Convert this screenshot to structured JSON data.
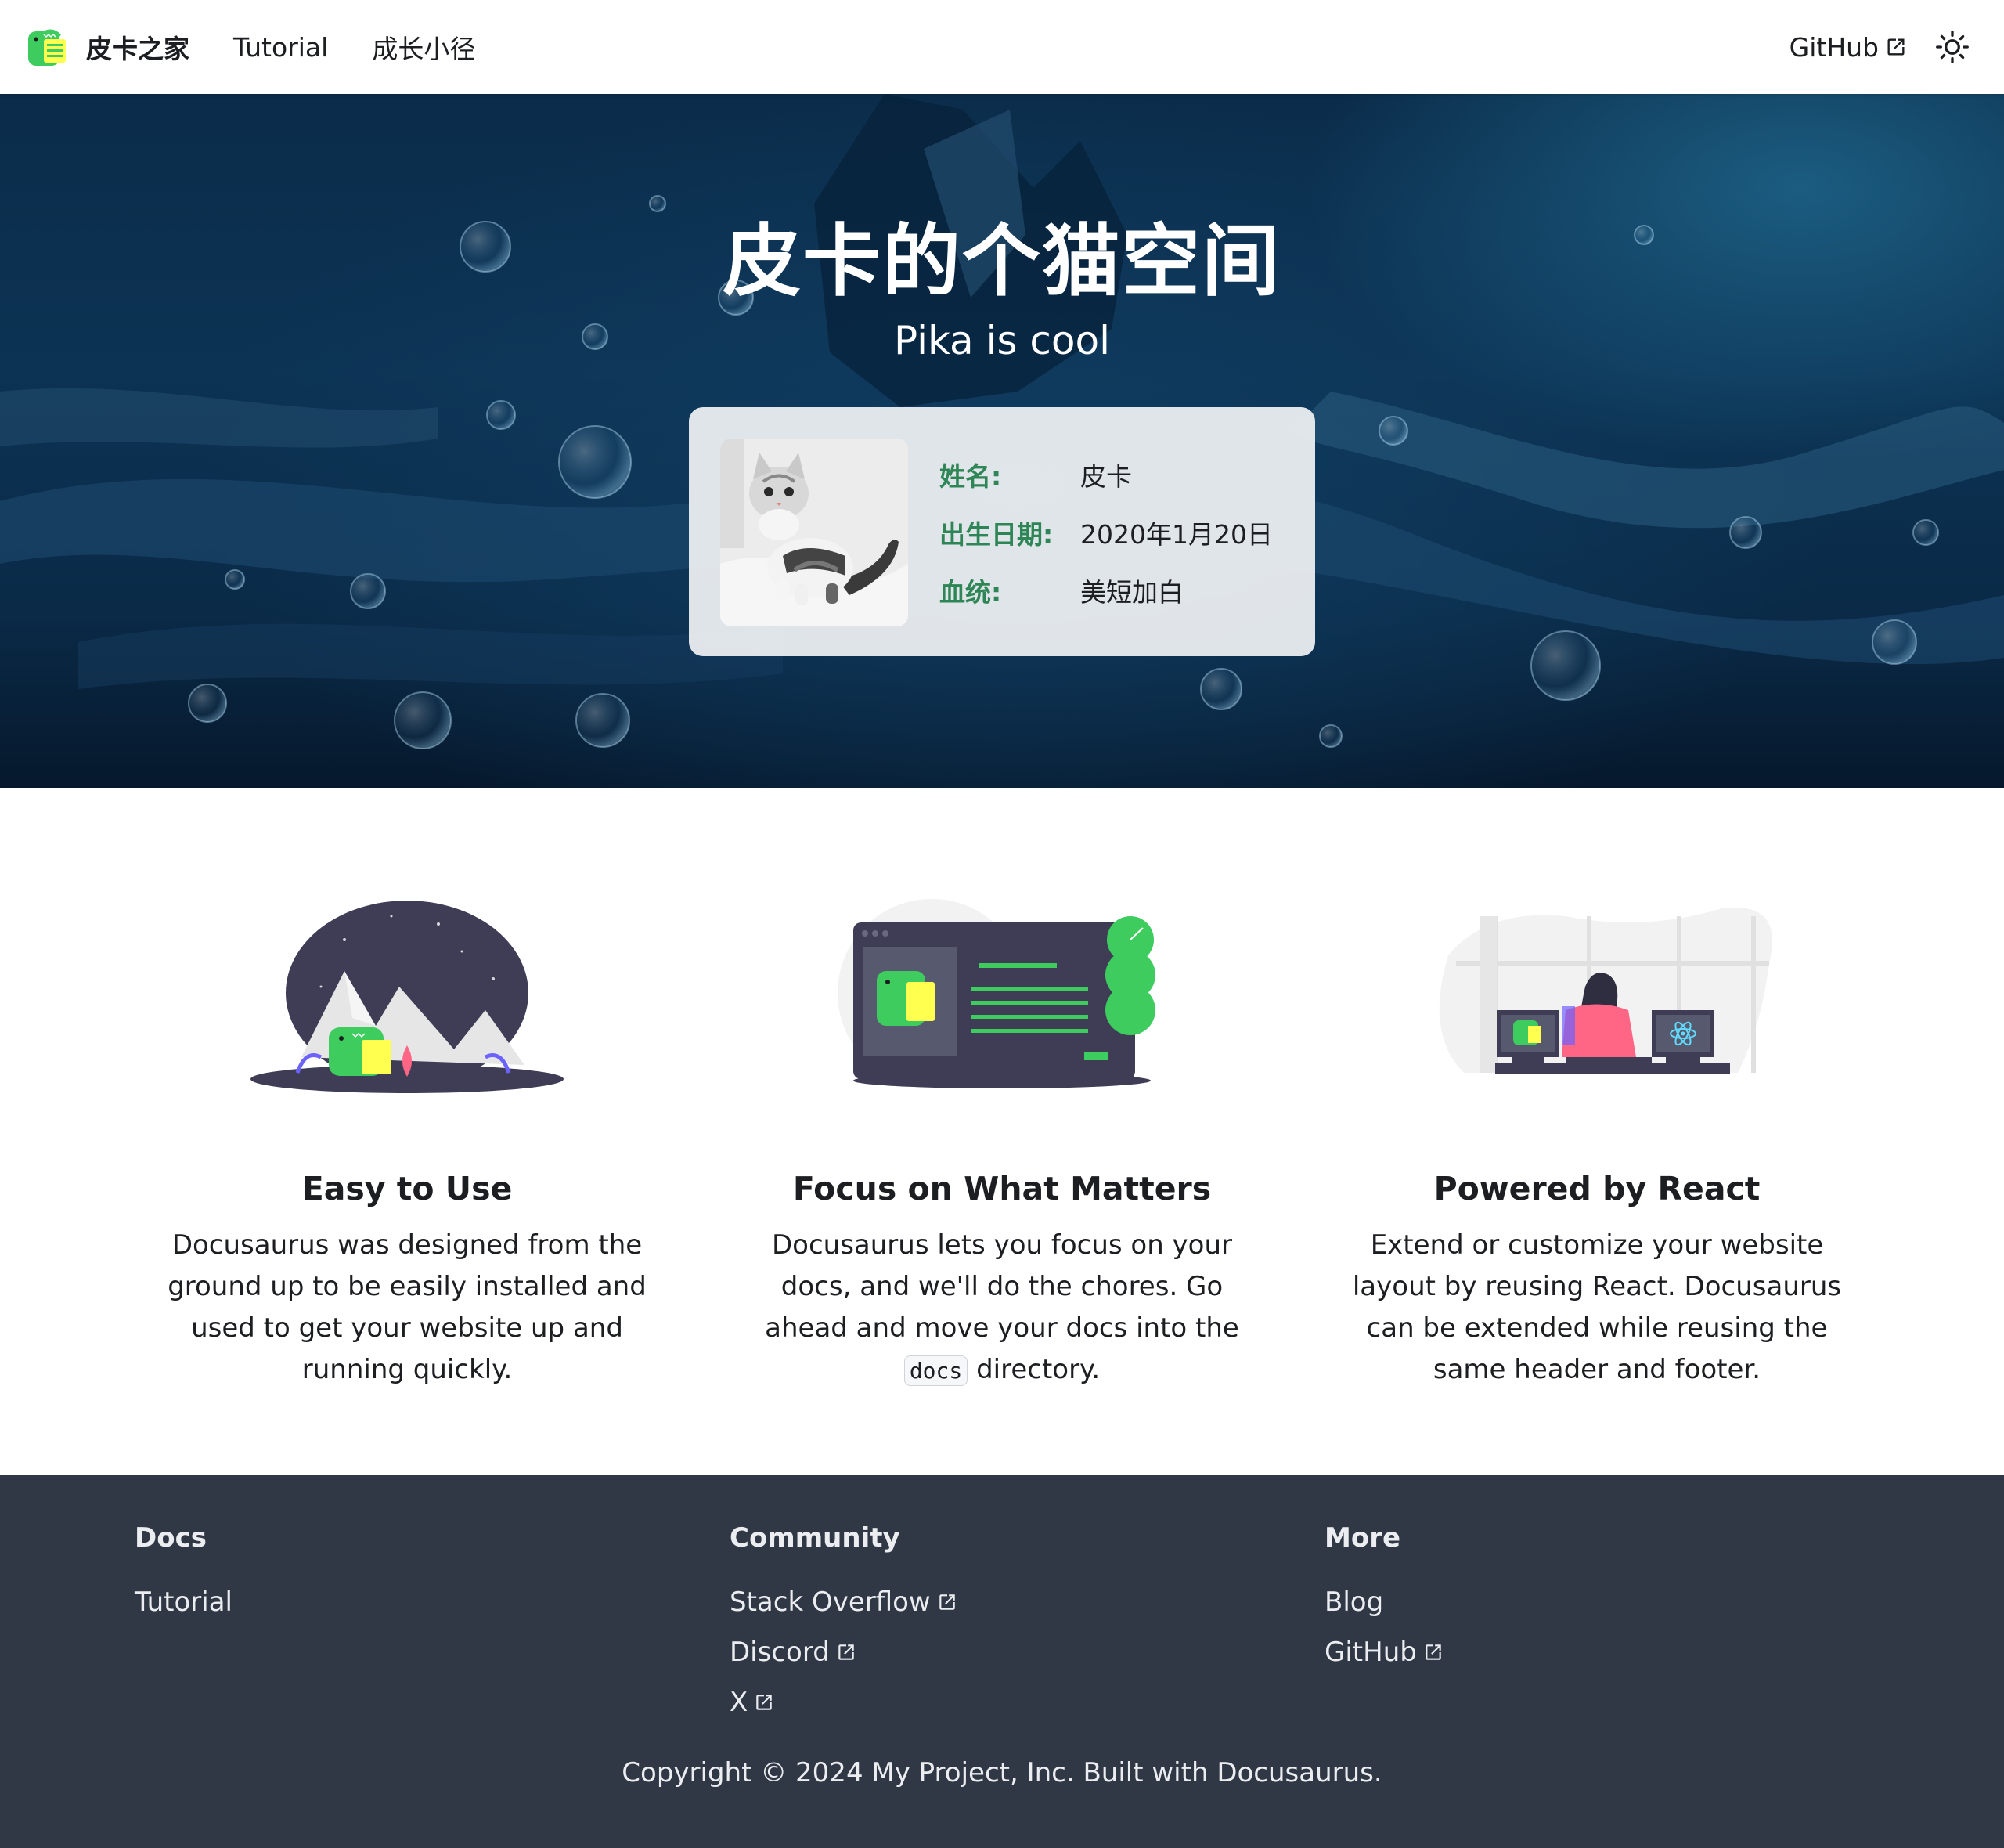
{
  "navbar": {
    "brand": "皮卡之家",
    "links": [
      "Tutorial",
      "成长小径"
    ],
    "github": "GitHub"
  },
  "hero": {
    "title": "皮卡的个猫空间",
    "subtitle": "Pika is cool",
    "profile": {
      "name_label": "姓名:",
      "name_value": "皮卡",
      "birth_label": "出生日期:",
      "birth_value": "2020年1月20日",
      "breed_label": "血统:",
      "breed_value": "美短加白"
    }
  },
  "features": [
    {
      "title": "Easy to Use",
      "desc": "Docusaurus was designed from the ground up to be easily installed and used to get your website up and running quickly."
    },
    {
      "title": "Focus on What Matters",
      "desc_before": "Docusaurus lets you focus on your docs, and we'll do the chores. Go ahead and move your docs into the",
      "code": "docs",
      "desc_after": "directory."
    },
    {
      "title": "Powered by React",
      "desc": "Extend or customize your website layout by reusing React. Docusaurus can be extended while reusing the same header and footer."
    }
  ],
  "footer": {
    "columns": [
      {
        "title": "Docs",
        "links": [
          "Tutorial"
        ]
      },
      {
        "title": "Community",
        "links": [
          "Stack Overflow",
          "Discord",
          "X"
        ]
      },
      {
        "title": "More",
        "links": [
          "Blog",
          "GitHub"
        ]
      }
    ],
    "copyright": "Copyright © 2024 My Project, Inc. Built with Docusaurus."
  },
  "colors": {
    "accent": "#2e8555",
    "footer_bg": "#303846",
    "hero_bg": "#0c3354"
  },
  "icons": [
    "dinosaur-logo-icon",
    "external-link-icon",
    "sun-icon"
  ]
}
